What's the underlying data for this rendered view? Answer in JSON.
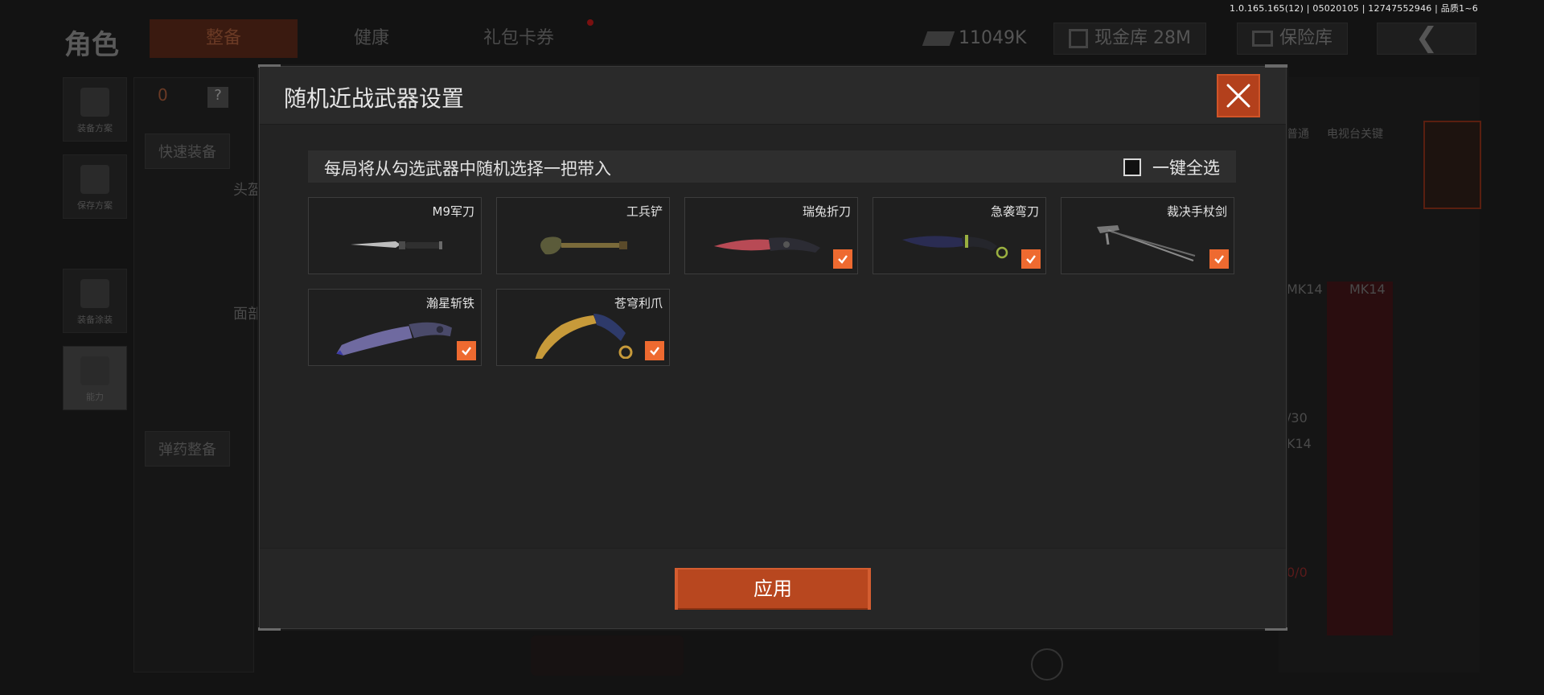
{
  "version": "1.0.165.165(12) | 05020105 | 12747552946 | 品质1~6",
  "background": {
    "title": "角色",
    "tabs": [
      "整备",
      "健康",
      "礼包卡券"
    ],
    "currency": "11049K",
    "cash_vault": "现金库 28M",
    "safe_box": "保险库",
    "side_items": [
      "装备方案",
      "保存方案",
      "装备涂装",
      "能力"
    ],
    "quick_equip": "快速装备",
    "ammo_equip": "弹药整备",
    "head_label": "头盔",
    "face_label": "面部",
    "backpack_count": "0",
    "help": "?",
    "right_labels": [
      "普通",
      "电视台关键"
    ],
    "slot_names": [
      "MK14",
      "MK14"
    ],
    "ammo": "/30",
    "ammo2": "K14",
    "zero": "0/0"
  },
  "dialog": {
    "title": "随机近战武器设置",
    "info_text": "每局将从勾选武器中随机选择一把带入",
    "select_all_label": "一键全选",
    "apply_label": "应用",
    "weapons": [
      {
        "name": "M9军刀",
        "checked": false,
        "icon": "knife-icon"
      },
      {
        "name": "工兵铲",
        "checked": false,
        "icon": "shovel-icon"
      },
      {
        "name": "瑞兔折刀",
        "checked": true,
        "icon": "folding-knife-icon"
      },
      {
        "name": "急袭弯刀",
        "checked": true,
        "icon": "curved-blade-icon"
      },
      {
        "name": "裁决手杖剑",
        "checked": true,
        "icon": "cane-sword-icon"
      },
      {
        "name": "瀚星斩铁",
        "checked": true,
        "icon": "tanto-knife-icon"
      },
      {
        "name": "苍穹利爪",
        "checked": true,
        "icon": "karambit-icon"
      }
    ]
  },
  "colors": {
    "accent": "#ee6a30",
    "close_bg": "#b3401c",
    "apply_bg": "#b8471f"
  }
}
